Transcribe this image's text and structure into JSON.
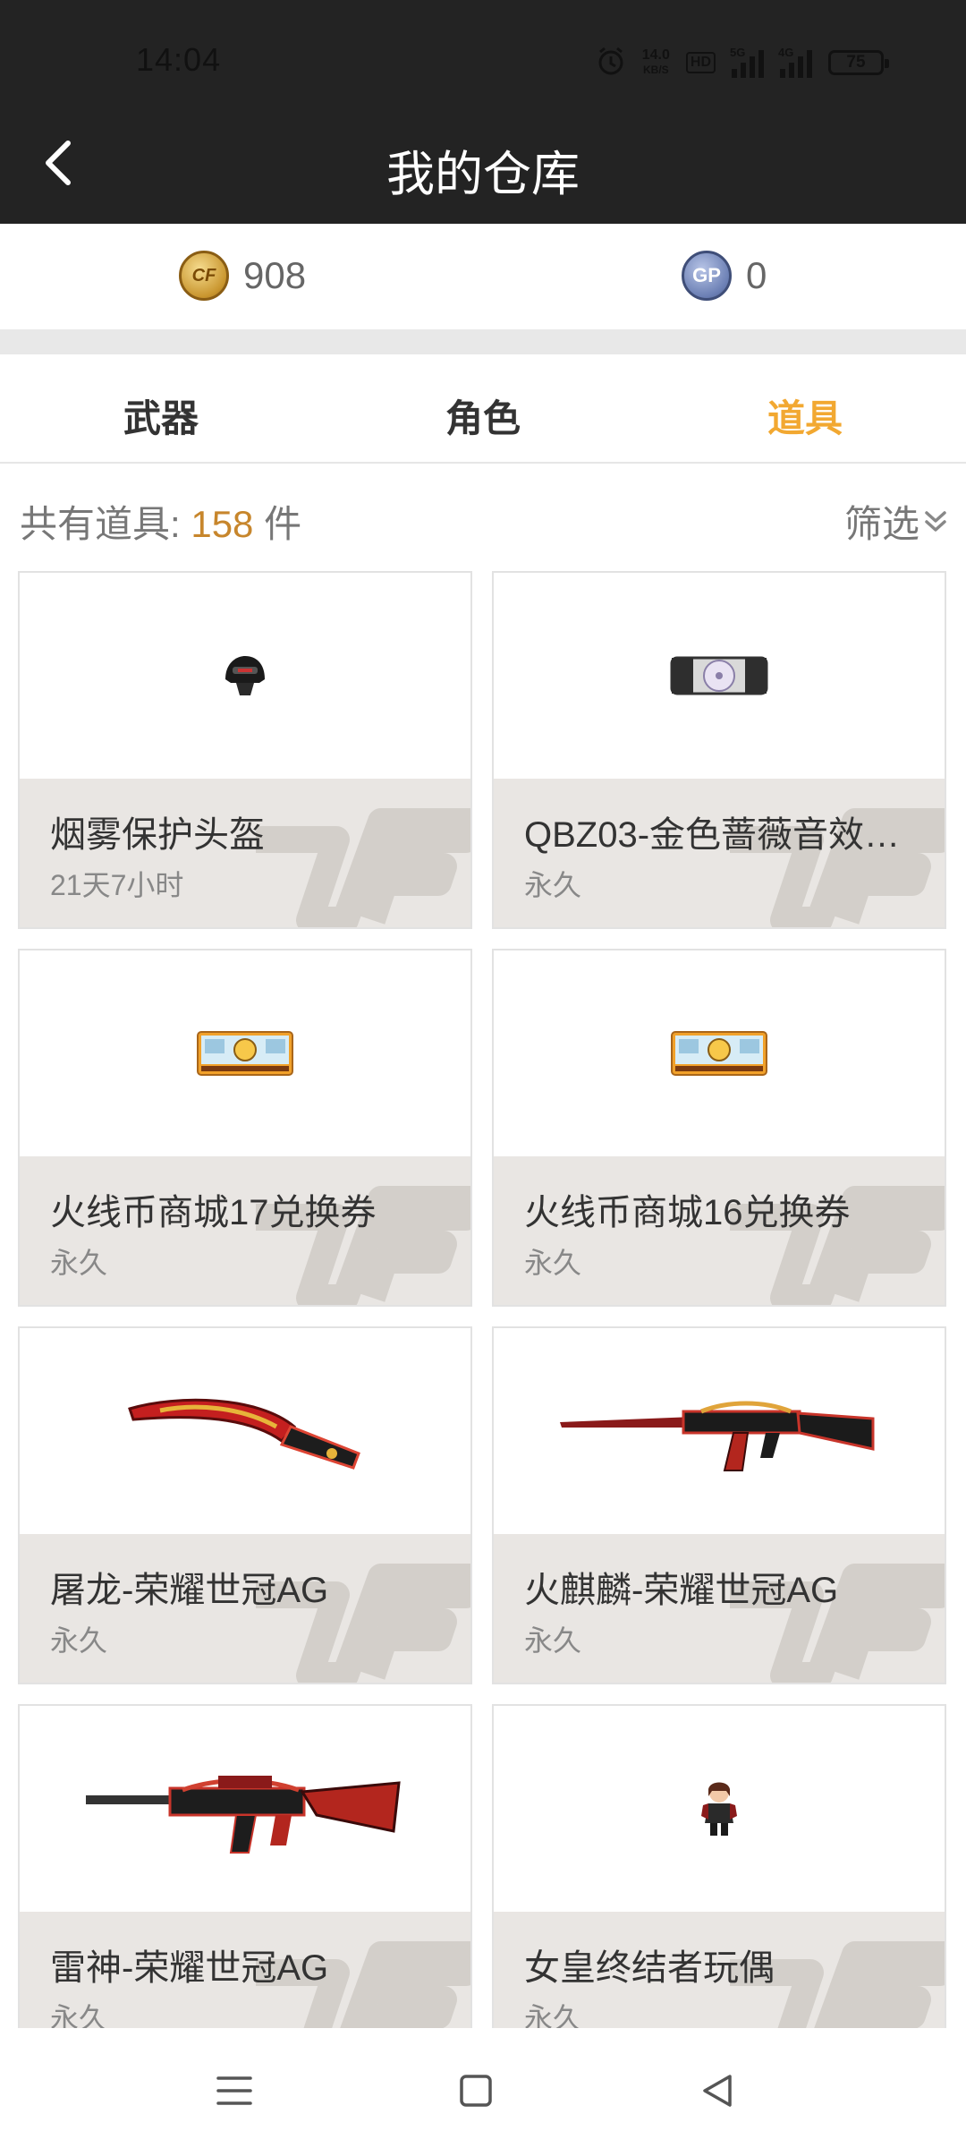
{
  "status_bar": {
    "time": "14:04",
    "net_speed_value": "14.0",
    "net_speed_unit": "KB/S",
    "hd_label": "HD",
    "signal1_label": "5G",
    "signal2_label": "4G",
    "battery": "75"
  },
  "header": {
    "title": "我的仓库"
  },
  "currency": {
    "cf_coin_amount": "908",
    "gp_amount": "0",
    "gp_icon_label": "GP",
    "cf_icon_label": "CF"
  },
  "tabs": [
    {
      "label": "武器",
      "active": false
    },
    {
      "label": "角色",
      "active": false
    },
    {
      "label": "道具",
      "active": true
    }
  ],
  "summary": {
    "prefix": "共有道具:",
    "count": "158",
    "suffix": "件",
    "filter_label": "筛选"
  },
  "items": [
    {
      "name": "烟雾保护头盔",
      "duration": "21天7小时",
      "icon": "helmet-icon"
    },
    {
      "name": "QBZ03-金色蔷薇音效卡...",
      "duration": "永久",
      "icon": "sound-card-icon"
    },
    {
      "name": "火线币商城17兑换券",
      "duration": "永久",
      "icon": "voucher-icon"
    },
    {
      "name": "火线币商城16兑换券",
      "duration": "永久",
      "icon": "voucher-icon"
    },
    {
      "name": "屠龙-荣耀世冠AG",
      "duration": "永久",
      "icon": "kukri-knife-icon"
    },
    {
      "name": "火麒麟-荣耀世冠AG",
      "duration": "永久",
      "icon": "ak-rifle-icon"
    },
    {
      "name": "雷神-荣耀世冠AG",
      "duration": "永久",
      "icon": "m4-rifle-icon"
    },
    {
      "name": "女皇终结者玩偶",
      "duration": "永久",
      "icon": "doll-figure-icon"
    }
  ],
  "colors": {
    "header_bg": "#232323",
    "active_tab": "#f2a831",
    "count_accent": "#c7862c",
    "card_info_bg": "#e9e6e3"
  }
}
